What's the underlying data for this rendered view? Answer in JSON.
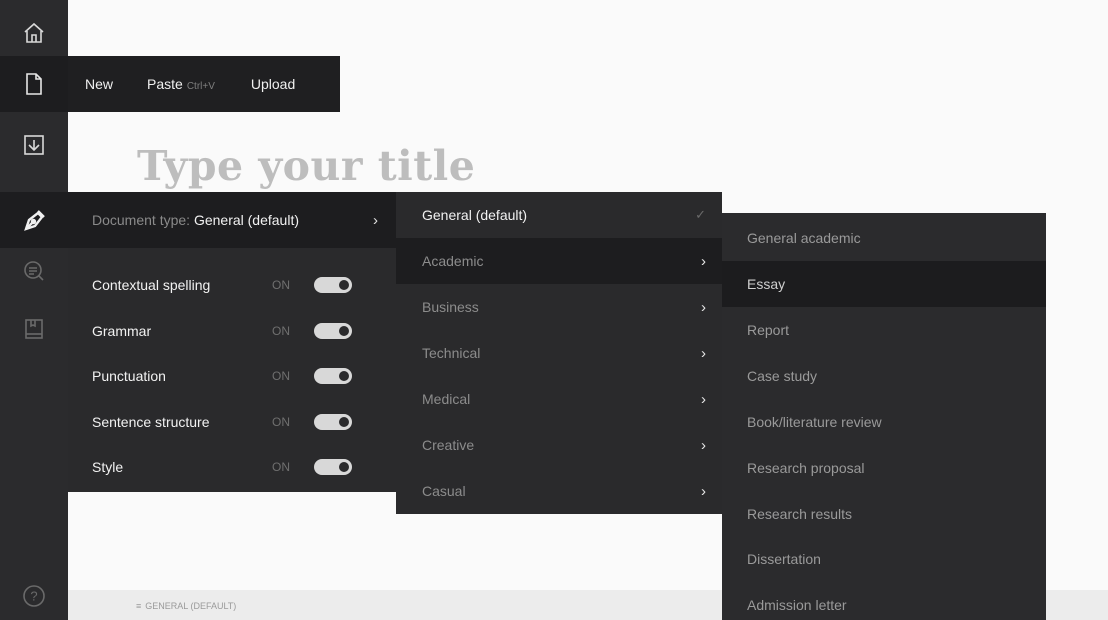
{
  "sidebar": {
    "items": [
      {
        "icon": "home-icon"
      },
      {
        "icon": "document-icon"
      },
      {
        "icon": "download-icon"
      },
      {
        "icon": "pen-icon"
      },
      {
        "icon": "search-list-icon"
      },
      {
        "icon": "book-icon"
      },
      {
        "icon": "help-icon"
      }
    ],
    "help_label": "?"
  },
  "file_menu": {
    "new_label": "New",
    "paste_label": "Paste",
    "paste_shortcut": "Ctrl+V",
    "upload_label": "Upload"
  },
  "editor": {
    "title_placeholder": "Type your title",
    "status_icon": "≡",
    "status_label": "GENERAL (DEFAULT)"
  },
  "settings": {
    "doc_type_label": "Document type:",
    "doc_type_value": "General (default)",
    "chevron": "›",
    "options": [
      {
        "label": "Contextual spelling",
        "state": "ON"
      },
      {
        "label": "Grammar",
        "state": "ON"
      },
      {
        "label": "Punctuation",
        "state": "ON"
      },
      {
        "label": "Sentence structure",
        "state": "ON"
      },
      {
        "label": "Style",
        "state": "ON"
      }
    ]
  },
  "types_menu": {
    "items": [
      {
        "label": "General (default)",
        "marker": "✓"
      },
      {
        "label": "Academic",
        "marker": "›"
      },
      {
        "label": "Business",
        "marker": "›"
      },
      {
        "label": "Technical",
        "marker": "›"
      },
      {
        "label": "Medical",
        "marker": "›"
      },
      {
        "label": "Creative",
        "marker": "›"
      },
      {
        "label": "Casual",
        "marker": "›"
      }
    ]
  },
  "academic_menu": {
    "items": [
      "General academic",
      "Essay",
      "Report",
      "Case study",
      "Book/literature review",
      "Research proposal",
      "Research results",
      "Dissertation",
      "Admission letter"
    ]
  },
  "colors": {
    "rail": "#2b2b2d",
    "panel": "#2a2a2c",
    "highlight": "#1d1d1f",
    "title_placeholder": "#bdbdbd"
  }
}
